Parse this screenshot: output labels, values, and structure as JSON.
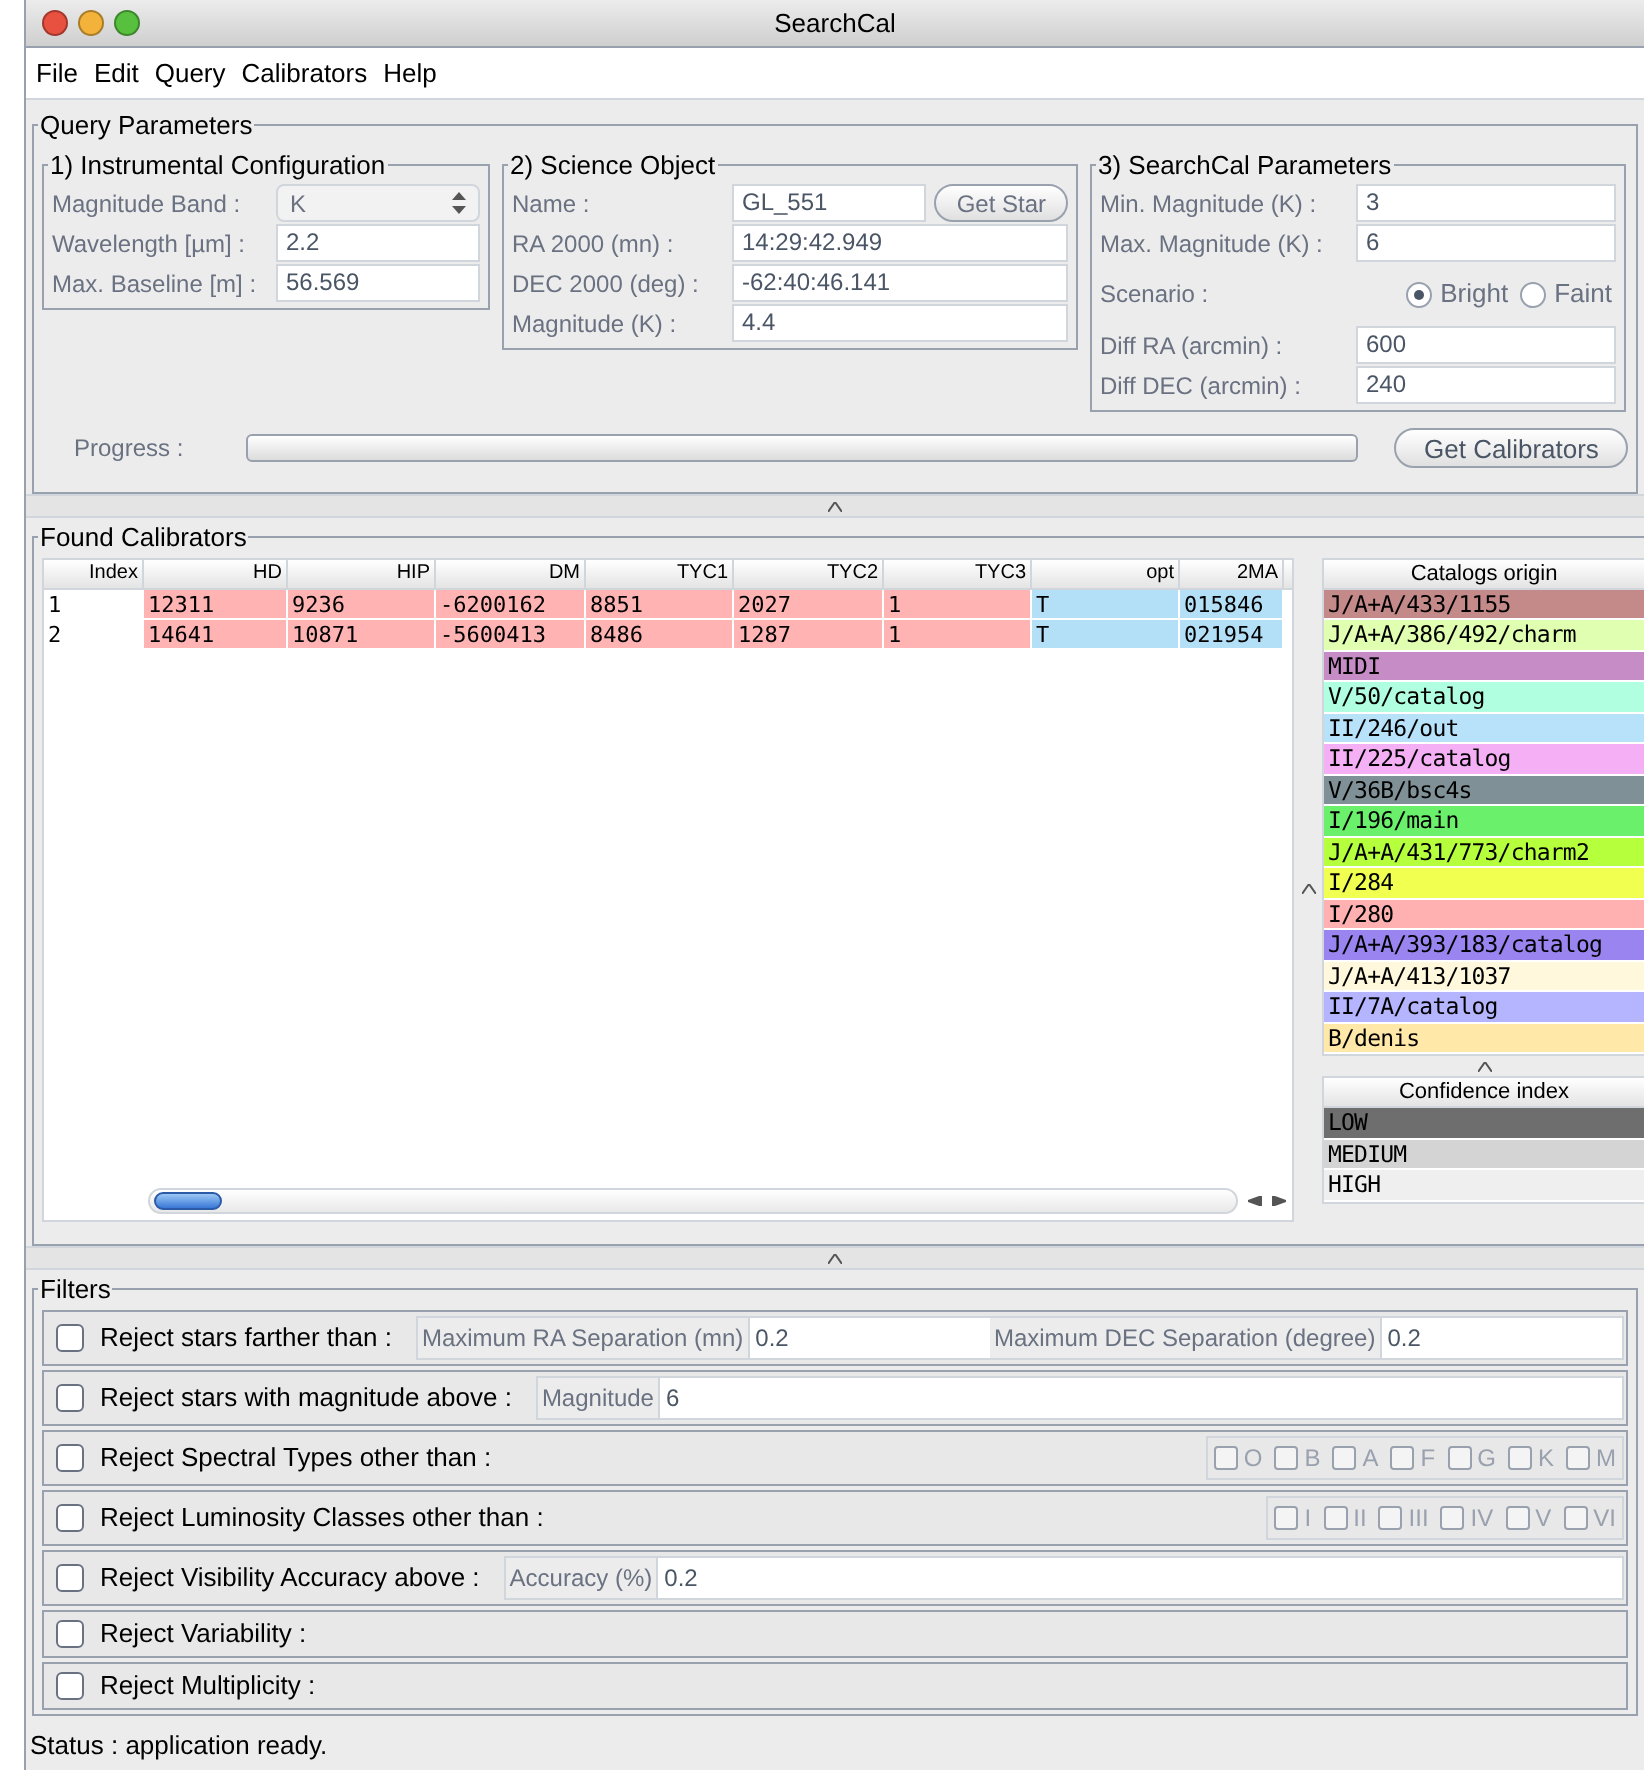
{
  "window": {
    "title": "SearchCal"
  },
  "menu": [
    "File",
    "Edit",
    "Query",
    "Calibrators",
    "Help"
  ],
  "query_parameters": {
    "title": "Query Parameters",
    "groups": [
      {
        "title": "1)  Instrumental Configuration",
        "rows": [
          {
            "kind": "select",
            "label": "Magnitude Band :",
            "value": "K"
          },
          {
            "kind": "text",
            "label": "Wavelength [µm] :",
            "value": "2.2"
          },
          {
            "kind": "text",
            "label": "Max. Baseline [m] :",
            "value": "56.569"
          }
        ]
      },
      {
        "title": "2)  Science Object",
        "rows": [
          {
            "kind": "text",
            "label": "Name :",
            "value": "GL_551",
            "button": "Get Star"
          },
          {
            "kind": "text",
            "label": "RA 2000 (mn) :",
            "value": "14:29:42.949"
          },
          {
            "kind": "text",
            "label": "DEC 2000 (deg) :",
            "value": "-62:40:46.141"
          },
          {
            "kind": "text",
            "label": "Magnitude (K) :",
            "value": "4.4"
          }
        ]
      },
      {
        "title": "3)  SearchCal Parameters",
        "rows": [
          {
            "kind": "text",
            "label": "Min. Magnitude (K) :",
            "value": "3"
          },
          {
            "kind": "text",
            "label": "Max. Magnitude (K) :",
            "value": "6"
          },
          {
            "kind": "radio",
            "label": "Scenario :",
            "options": [
              {
                "label": "Bright",
                "selected": true
              },
              {
                "label": "Faint",
                "selected": false
              }
            ]
          },
          {
            "kind": "text",
            "label": "Diff RA (arcmin) :",
            "value": "600"
          },
          {
            "kind": "text",
            "label": "Diff DEC (arcmin) :",
            "value": "240"
          }
        ]
      }
    ],
    "progress": {
      "label": "Progress :",
      "level": 0
    },
    "button": "Get Calibrators"
  },
  "found_calibrators": {
    "title": "Found Calibrators",
    "columns": [
      {
        "label": "Index"
      },
      {
        "label": "HD",
        "color": "#ffb3b3"
      },
      {
        "label": "HIP",
        "color": "#ffb3b3"
      },
      {
        "label": "DM",
        "color": "#ffb3b3"
      },
      {
        "label": "TYC1",
        "color": "#ffb3b3"
      },
      {
        "label": "TYC2",
        "color": "#ffb3b3"
      },
      {
        "label": "TYC3",
        "color": "#ffb3b3"
      },
      {
        "label": "opt",
        "color": "#b3e0f7"
      },
      {
        "label": "2MA",
        "color": "#b3e0f7"
      }
    ],
    "rows": [
      [
        "1",
        "12311",
        "9236",
        "-6200162",
        "8851",
        "2027",
        "1",
        "T",
        "015846"
      ],
      [
        "2",
        "14641",
        "10871",
        "-5600413",
        "8486",
        "1287",
        "1",
        "T",
        "021954"
      ]
    ],
    "catalogs": {
      "title": "Catalogs origin",
      "items": [
        {
          "label": "J/A+A/433/1155",
          "color": "#c48a8a"
        },
        {
          "label": "J/A+A/386/492/charm",
          "color": "#e0ffb0"
        },
        {
          "label": "MIDI",
          "color": "#c68cc6"
        },
        {
          "label": "V/50/catalog",
          "color": "#b0ffe0"
        },
        {
          "label": "II/246/out",
          "color": "#b8e2fa"
        },
        {
          "label": "II/225/catalog",
          "color": "#f5b0f5"
        },
        {
          "label": "V/36B/bsc4s",
          "color": "#7f9196"
        },
        {
          "label": "I/196/main",
          "color": "#6af06a"
        },
        {
          "label": "J/A+A/431/773/charm2",
          "color": "#b6ff3c"
        },
        {
          "label": "I/284",
          "color": "#f0ff50"
        },
        {
          "label": "I/280",
          "color": "#ffb0b0"
        },
        {
          "label": "J/A+A/393/183/catalog",
          "color": "#9a84f0"
        },
        {
          "label": "J/A+A/413/1037",
          "color": "#fff8dc"
        },
        {
          "label": "II/7A/catalog",
          "color": "#b4b4ff"
        },
        {
          "label": "B/denis",
          "color": "#ffe8a8"
        }
      ]
    },
    "confidence": {
      "title": "Confidence index",
      "items": [
        {
          "label": "LOW",
          "color": "#6e6e6e"
        },
        {
          "label": "MEDIUM",
          "color": "#d4d4d4"
        },
        {
          "label": "HIGH",
          "color": "#efefef"
        }
      ]
    }
  },
  "filters": {
    "title": "Filters",
    "rows": [
      {
        "kind": "fields",
        "label": "Reject stars farther than :",
        "checked": false,
        "fields": [
          {
            "label": "Maximum RA Separation (mn)",
            "value": "0.2"
          },
          {
            "label": "Maximum DEC Separation (degree)",
            "value": "0.2"
          }
        ]
      },
      {
        "kind": "fields",
        "label": "Reject stars with magnitude above :",
        "checked": false,
        "fields": [
          {
            "label": "Magnitude",
            "value": "6"
          }
        ]
      },
      {
        "kind": "checks",
        "label": "Reject Spectral Types other than :",
        "checked": false,
        "options": [
          {
            "label": "O",
            "checked": false
          },
          {
            "label": "B",
            "checked": false
          },
          {
            "label": "A",
            "checked": false
          },
          {
            "label": "F",
            "checked": false
          },
          {
            "label": "G",
            "checked": false
          },
          {
            "label": "K",
            "checked": false
          },
          {
            "label": "M",
            "checked": false
          }
        ]
      },
      {
        "kind": "checks",
        "label": "Reject Luminosity Classes other than :",
        "checked": false,
        "options": [
          {
            "label": "I",
            "checked": false
          },
          {
            "label": "II",
            "checked": false
          },
          {
            "label": "III",
            "checked": false
          },
          {
            "label": "IV",
            "checked": false
          },
          {
            "label": "V",
            "checked": false
          },
          {
            "label": "VI",
            "checked": false
          }
        ]
      },
      {
        "kind": "fields",
        "label": "Reject Visibility Accuracy above :",
        "checked": false,
        "fields": [
          {
            "label": "Accuracy (%)",
            "value": "0.2"
          }
        ]
      },
      {
        "kind": "plain",
        "label": "Reject Variability :",
        "checked": false
      },
      {
        "kind": "plain",
        "label": "Reject Multiplicity :",
        "checked": false
      }
    ]
  },
  "status_bar": "Status : application ready."
}
